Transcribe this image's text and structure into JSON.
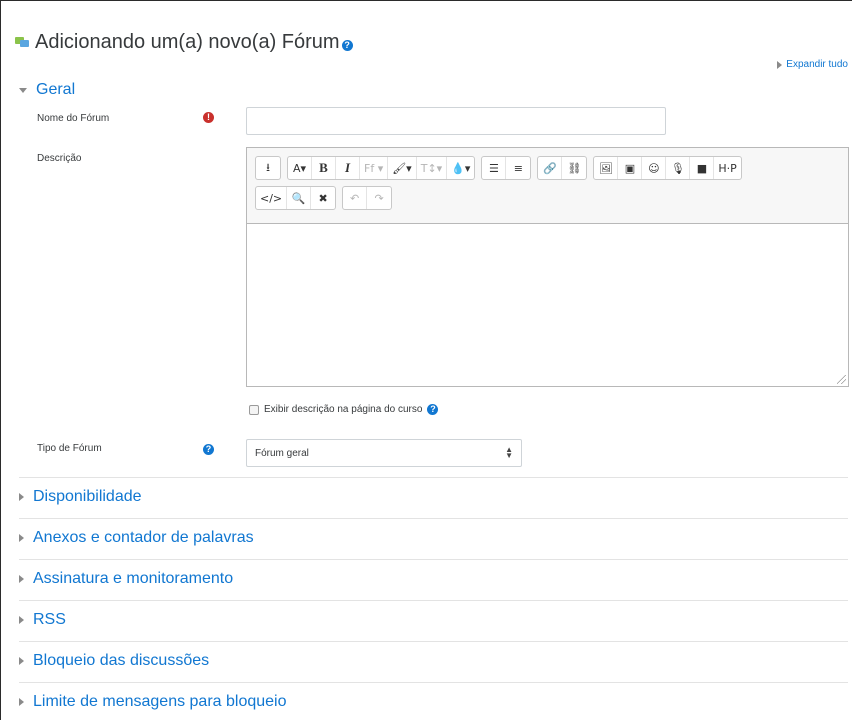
{
  "header": {
    "title": "Adicionando um(a) novo(a) Fórum",
    "help_icon": "question-circle-icon",
    "forum_icon": "forum-chat-icon",
    "expand_all": "Expandir tudo"
  },
  "general": {
    "section_title": "Geral",
    "name_label": "Nome do Fórum",
    "name_value": "",
    "required_icon": "exclamation-circle-icon",
    "description_label": "Descrição",
    "show_description_label": "Exibir descrição na página do curso",
    "forum_type_label": "Tipo de Fórum",
    "forum_type_value": "Fórum geral"
  },
  "editor_toolbar": {
    "row1": [
      [
        {
          "name": "show-more-icon",
          "glyph": "⭳"
        }
      ],
      [
        {
          "name": "font-color-icon",
          "glyph": "A▾"
        },
        {
          "name": "bold-icon",
          "glyph": "B"
        },
        {
          "name": "italic-icon",
          "glyph": "I"
        },
        {
          "name": "font-family-icon",
          "glyph": "Ff ▾"
        },
        {
          "name": "brush-icon",
          "glyph": "🖌▾"
        },
        {
          "name": "font-size-icon",
          "glyph": "T↕▾"
        },
        {
          "name": "background-color-icon",
          "glyph": "💧▾"
        }
      ],
      [
        {
          "name": "unordered-list-icon",
          "glyph": "☰"
        },
        {
          "name": "ordered-list-icon",
          "glyph": "≡"
        }
      ],
      [
        {
          "name": "link-icon",
          "glyph": "🔗"
        },
        {
          "name": "unlink-icon",
          "glyph": "⛓"
        }
      ],
      [
        {
          "name": "image-icon",
          "glyph": "🖼"
        },
        {
          "name": "media-icon",
          "glyph": "▣"
        },
        {
          "name": "emoticon-icon",
          "glyph": "☺"
        },
        {
          "name": "record-audio-icon",
          "glyph": "🎙"
        },
        {
          "name": "record-video-icon",
          "glyph": "■"
        },
        {
          "name": "h5p-icon",
          "glyph": "H·P"
        }
      ]
    ],
    "row2": [
      [
        {
          "name": "html-icon",
          "glyph": "</>"
        },
        {
          "name": "find-replace-icon",
          "glyph": "🔍"
        },
        {
          "name": "fullscreen-icon",
          "glyph": "✖"
        }
      ],
      [
        {
          "name": "undo-icon",
          "glyph": "↶"
        },
        {
          "name": "redo-icon",
          "glyph": "↷"
        }
      ]
    ]
  },
  "sections": [
    {
      "title": "Disponibilidade"
    },
    {
      "title": "Anexos e contador de palavras"
    },
    {
      "title": "Assinatura e monitoramento"
    },
    {
      "title": "RSS"
    },
    {
      "title": "Bloqueio das discussões"
    },
    {
      "title": "Limite de mensagens para bloqueio"
    }
  ],
  "colors": {
    "link": "#1177d1",
    "required": "#c9302c",
    "forum_icon": "#8bc34a"
  }
}
